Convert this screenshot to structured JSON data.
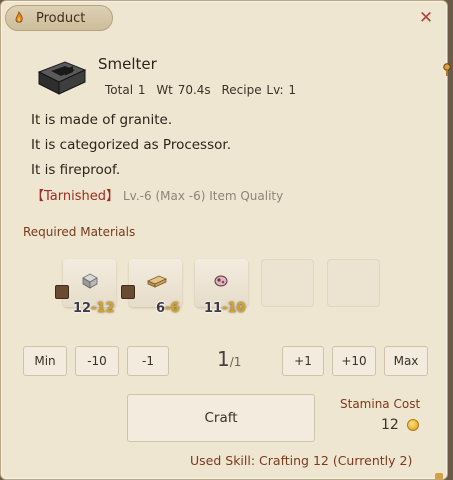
{
  "window": {
    "title": "Product",
    "close_symbol": "✕",
    "title_icon": "flame-icon"
  },
  "item": {
    "name": "Smelter",
    "meta_total": "Total 1",
    "meta_weight": "Wt 70.4s",
    "meta_recipe": "Recipe Lv: 1",
    "icon": "smelter-item-icon",
    "descriptions": [
      "It is made of granite.",
      "It is categorized as Processor.",
      "It is fireproof."
    ],
    "quality_tag": "【Tarnished】",
    "quality_info": "Lv.-6 (Max -6) Item Quality"
  },
  "materials": {
    "label": "Required Materials",
    "slots": [
      {
        "icon": "stone-block-icon",
        "have": "12",
        "need": "-12"
      },
      {
        "icon": "wood-plank-icon",
        "have": "6",
        "need": "-6"
      },
      {
        "icon": "ore-chunk-icon",
        "have": "11",
        "need": "-10"
      }
    ]
  },
  "quantity": {
    "min_label": "Min",
    "minus10_label": "-10",
    "minus1_label": "-1",
    "current": "1",
    "max": "/1",
    "plus1_label": "+1",
    "plus10_label": "+10",
    "max_label": "Max"
  },
  "craft": {
    "button_label": "Craft",
    "stamina_label": "Stamina Cost",
    "stamina_value": "12",
    "skill_text": "Used Skill: Crafting 12 (Currently 2)"
  },
  "colors": {
    "panel_bg": "#efe6d2",
    "accent_label": "#7a3a1c",
    "quality_red": "#a22a22",
    "need_gold": "#d1a432"
  }
}
